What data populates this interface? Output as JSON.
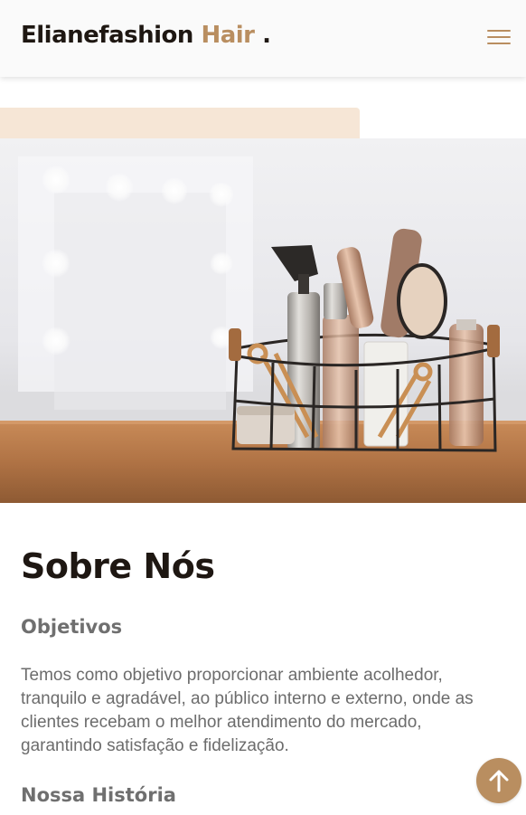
{
  "header": {
    "brand_main": "Elianefashion",
    "brand_accent": "Hair",
    "brand_dot": ".",
    "menu_icon": "hamburger-menu-icon"
  },
  "hero": {
    "image": "salon-tools-basket-illustration"
  },
  "about": {
    "title": "Sobre Nós",
    "objectives_heading": "Objetivos",
    "objectives_text": "Temos como objetivo proporcionar ambiente acolhedor, tranquilo e agradável, ao público interno e externo, onde as clientes recebam o melhor atendimento do mercado, garantindo satisfação e fidelização.",
    "history_heading": "Nossa História"
  },
  "scroll_top": {
    "icon": "arrow-up-icon"
  },
  "colors": {
    "accent": "#b98e60",
    "dark": "#1e1712",
    "deco": "#f6e6d6",
    "text": "#6c6c6c"
  }
}
